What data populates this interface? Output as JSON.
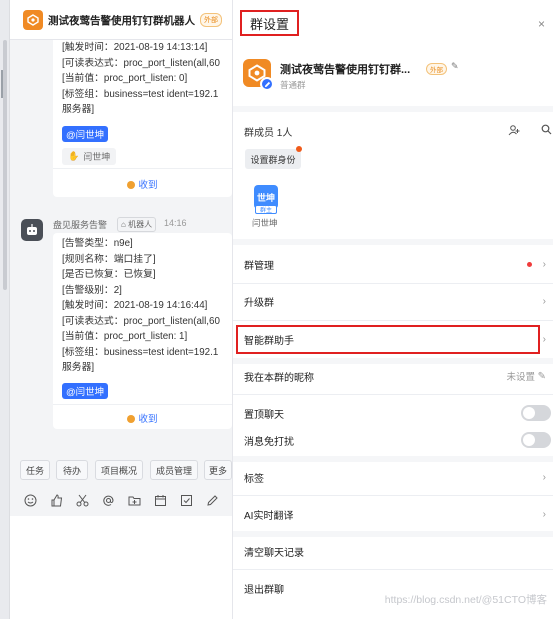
{
  "chat": {
    "title": "测试夜莺告警使用钉钉群机器人",
    "title_badge": "外部",
    "message1": {
      "lines": [
        "[触发时间：2021-08-19 14:13:14]",
        "[可读表达式：proc_port_listen(all,60",
        "[当前值：proc_port_listen: 0]",
        "[标签组：business=test ident=192.1",
        "服务器]"
      ],
      "mention": "@闫世坤",
      "reaction_user": "闫世坤",
      "received": "收到"
    },
    "message2": {
      "sender": "盘见服务告警",
      "sender_tag": "机器人",
      "time": "14:16",
      "lines": [
        "[告警类型：n9e]",
        "[规则名称：端口挂了]",
        "[是否已恢复：已恢复]",
        "[告警级别：2]",
        "[触发时间：2021-08-19 14:16:44]",
        "[可读表达式：proc_port_listen(all,60",
        "[当前值：proc_port_listen: 1]",
        "[标签组：business=test ident=192.1",
        "服务器]"
      ],
      "mention": "@闫世坤",
      "received": "收到"
    },
    "toolbar": [
      "任务",
      "待办",
      "项目概况",
      "成员管理",
      "更多"
    ],
    "input_icons": [
      "emoji-icon",
      "thumbs-up-icon",
      "scissors-icon",
      "at-icon",
      "folder-add-icon",
      "calendar-icon",
      "check-square-icon",
      "edit-icon"
    ]
  },
  "panel": {
    "title": "群设置",
    "close": "×",
    "group_name": "测试夜莺告警使用钉钉群...",
    "group_badge": "外部",
    "group_type": "普通群",
    "members_label": "群成员 1人",
    "role_button": "设置群身份",
    "member": {
      "avatar_text": "世坤",
      "role": "群主",
      "name": "闫世坤"
    },
    "rows": {
      "manage": "群管理",
      "upgrade": "升级群",
      "assistant": "智能群助手",
      "nickname": "我在本群的昵称",
      "nickname_value": "未设置",
      "pin": "置顶聊天",
      "mute": "消息免打扰",
      "tags": "标签",
      "ai_translate": "AI实时翻译",
      "clear": "清空聊天记录",
      "exit": "退出群聊"
    },
    "watermark": "https://blog.csdn.net/@51CTO博客"
  },
  "colors": {
    "accent": "#3370ff",
    "brand_orange": "#f08a24",
    "highlight_red": "#e02020"
  }
}
